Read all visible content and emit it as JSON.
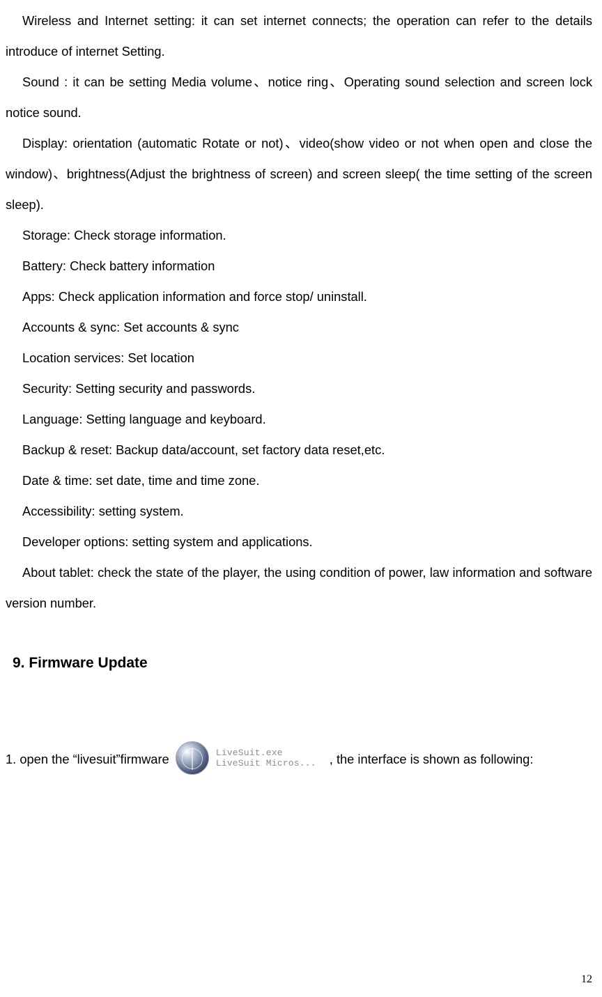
{
  "paragraphs": [
    "Wireless and Internet setting: it can set internet connects; the operation can refer to the details introduce of internet Setting.",
    "Sound : it can be setting Media volume、notice ring、Operating sound selection and screen lock notice sound.",
    "Display: orientation (automatic Rotate or not)、video(show video or not when open and close the window)、brightness(Adjust the brightness of screen) and screen sleep( the time setting of the screen sleep).",
    "Storage: Check storage information.",
    "Battery: Check battery information",
    "Apps: Check application information and force stop/ uninstall.",
    "Accounts & sync: Set accounts & sync",
    "Location services: Set location",
    "Security: Setting security and passwords.",
    "Language: Setting language and keyboard.",
    "Backup & reset: Backup data/account, set factory data reset,etc.",
    "Date & time: set date, time and time zone.",
    "Accessibility: setting system.",
    "Developer options: setting system and applications.",
    "About tablet: check the state of the player, the using condition of power, law information and software version number."
  ],
  "heading": "9. Firmware Update",
  "firmware_step": {
    "pre": "1. open the “livesuit”firmware ",
    "post": ", the interface is shown as following:",
    "icon_label_line1": "LiveSuit.exe",
    "icon_label_line2": "LiveSuit Micros..."
  },
  "page_number": "12"
}
